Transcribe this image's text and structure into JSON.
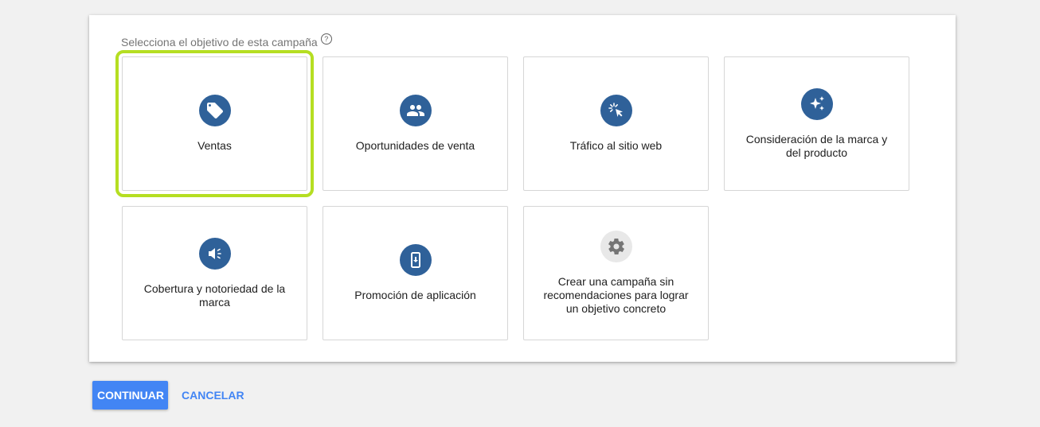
{
  "prompt": {
    "text": "Selecciona el objetivo de esta campaña",
    "help_glyph": "?"
  },
  "objectives": [
    {
      "label": "Ventas",
      "icon": "tag-icon",
      "selected": true
    },
    {
      "label": "Oportunidades de venta",
      "icon": "people-icon",
      "selected": false
    },
    {
      "label": "Tráfico al sitio web",
      "icon": "cursor-click-icon",
      "selected": false
    },
    {
      "label": "Consideración de la marca y del producto",
      "icon": "sparkle-icon",
      "selected": false
    },
    {
      "label": "Cobertura y notoriedad de la marca",
      "icon": "megaphone-icon",
      "selected": false
    },
    {
      "label": "Promoción de aplicación",
      "icon": "phone-download-icon",
      "selected": false
    },
    {
      "label": "Crear una campaña sin recomendaciones para lograr un objetivo concreto",
      "icon": "gear-icon",
      "selected": false
    }
  ],
  "actions": {
    "continue_label": "CONTINUAR",
    "cancel_label": "CANCELAR"
  },
  "colors": {
    "icon_bg": "#2f6199",
    "selected_outline": "#b5de22",
    "primary": "#4285f4"
  }
}
